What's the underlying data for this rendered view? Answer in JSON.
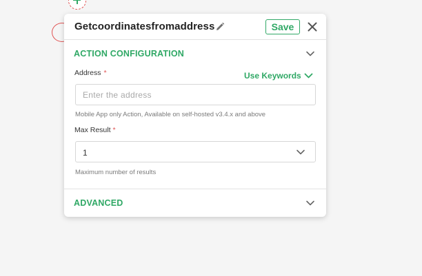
{
  "panel": {
    "title": "Getcoordinatesfromaddress",
    "save_label": "Save"
  },
  "sections": {
    "action_configuration": {
      "title": "ACTION CONFIGURATION",
      "expanded": true
    },
    "advanced": {
      "title": "ADVANCED",
      "expanded": false
    }
  },
  "fields": {
    "address": {
      "label": "Address",
      "required_mark": "*",
      "value": "",
      "placeholder": "Enter the address",
      "use_keywords_label": "Use Keywords",
      "hint": "Mobile App only Action, Available on self-hosted v3.4.x and above"
    },
    "max_result": {
      "label": "Max Result",
      "required_mark": "*",
      "value": "1",
      "hint": "Maximum number of results"
    }
  },
  "colors": {
    "accent": "#2fa865",
    "required": "#e05252",
    "text": "#222222",
    "hint": "#7a7a7a",
    "border": "#d6d6d6"
  },
  "icons": {
    "edit": "pencil-icon",
    "close": "close-icon",
    "chevron": "chevron-down-icon",
    "add_node": "plus-icon"
  }
}
